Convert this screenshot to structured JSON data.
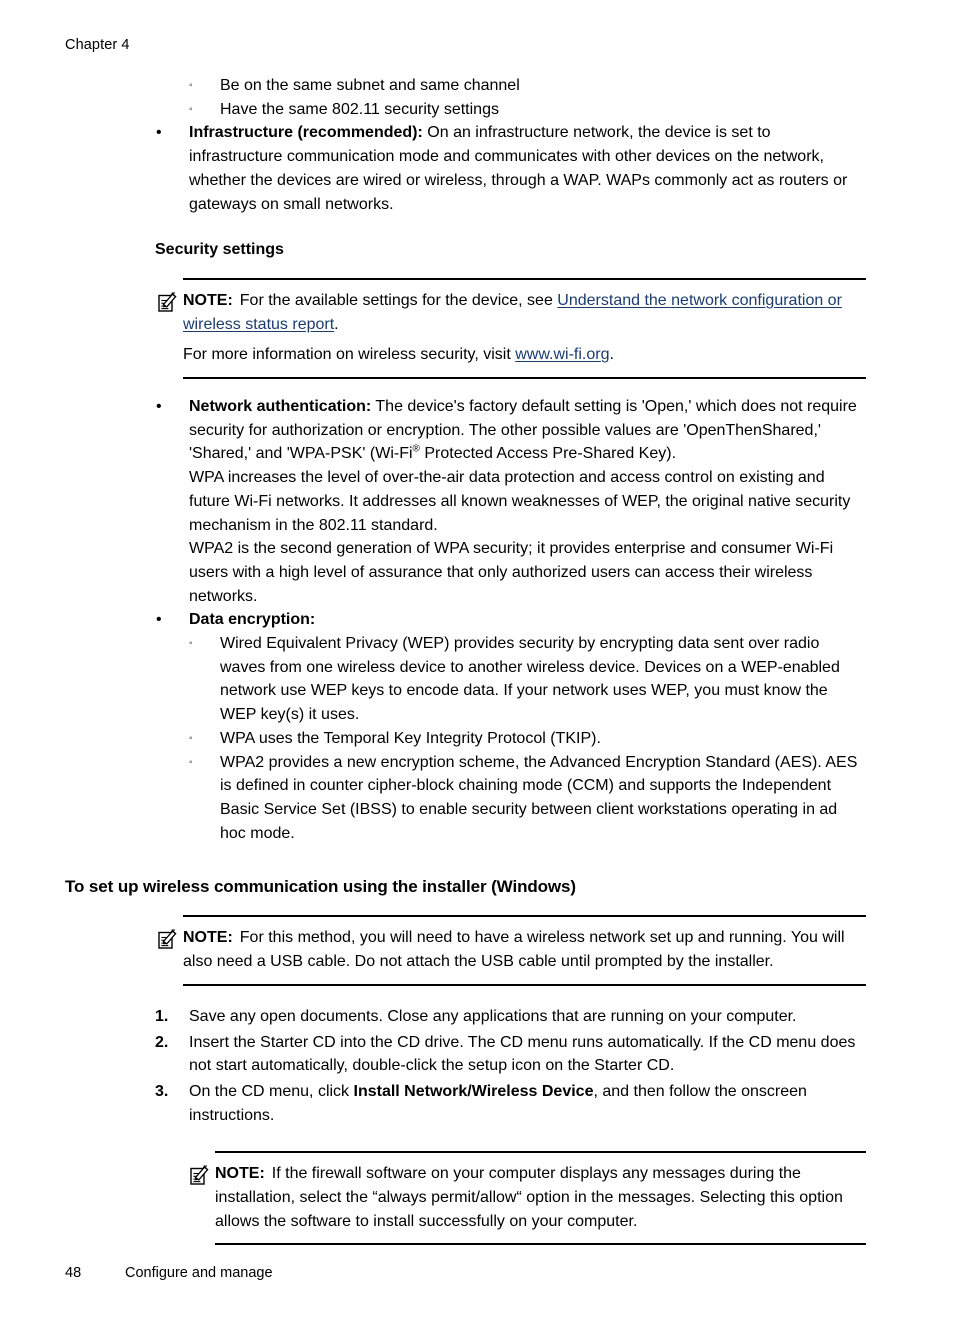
{
  "header": {
    "chapter": "Chapter 4"
  },
  "footer": {
    "page_number": "48",
    "section": "Configure and manage"
  },
  "ad_hoc_bullets": [
    "Be on the same subnet and same channel",
    "Have the same 802.11 security settings"
  ],
  "infrastructure": {
    "label": "Infrastructure (recommended):",
    "text": " On an infrastructure network, the device is set to infrastructure communication mode and communicates with other devices on the network, whether the devices are wired or wireless, through a WAP. WAPs commonly act as routers or gateways on small networks."
  },
  "security_settings_heading": "Security settings",
  "note_1": {
    "label": "NOTE:",
    "text_before_link": "For the available settings for the device, see ",
    "link_text": "Understand the network configuration or wireless status report",
    "text_after_link": ".",
    "second_para_before_link": "For more information on wireless security, visit ",
    "second_link_text": "www.wi-fi.org",
    "second_para_after_link": "."
  },
  "network_authentication": {
    "label": "Network authentication:",
    "text_part_1": " The device's factory default setting is 'Open,' which does not require security for authorization or encryption. The other possible values are 'OpenThenShared,' 'Shared,' and 'WPA-PSK' (Wi-Fi",
    "registered_mark": "®",
    "text_part_2": " Protected Access Pre-Shared Key).",
    "paragraph_2": "WPA increases the level of over-the-air data protection and access control on existing and future Wi-Fi networks. It addresses all known weaknesses of WEP, the original native security mechanism in the 802.11 standard.",
    "paragraph_3": "WPA2 is the second generation of WPA security; it provides enterprise and consumer Wi-Fi users with a high level of assurance that only authorized users can access their wireless networks."
  },
  "data_encryption": {
    "label": "Data encryption:",
    "items": [
      "Wired Equivalent Privacy (WEP) provides security by encrypting data sent over radio waves from one wireless device to another wireless device. Devices on a WEP-enabled network use WEP keys to encode data. If your network uses WEP, you must know the WEP key(s) it uses.",
      "WPA uses the Temporal Key Integrity Protocol (TKIP).",
      "WPA2 provides a new encryption scheme, the Advanced Encryption Standard (AES). AES is defined in counter cipher-block chaining mode (CCM) and supports the Independent Basic Service Set (IBSS) to enable security between client workstations operating in ad hoc mode."
    ]
  },
  "installer_section": {
    "heading": "To set up wireless communication using the installer (Windows)",
    "note": {
      "label": "NOTE:",
      "text": "For this method, you will need to have a wireless network set up and running. You will also need a USB cable. Do not attach the USB cable until prompted by the installer."
    },
    "steps": [
      {
        "number": "1.",
        "text": "Save any open documents. Close any applications that are running on your computer.",
        "bold_segment": "",
        "text_after_bold": ""
      },
      {
        "number": "2.",
        "text": "Insert the Starter CD into the CD drive. The CD menu runs automatically. If the CD menu does not start automatically, double-click the setup icon on the Starter CD.",
        "bold_segment": "",
        "text_after_bold": ""
      },
      {
        "number": "3.",
        "text": "On the CD menu, click ",
        "bold_segment": "Install Network/Wireless Device",
        "text_after_bold": ", and then follow the onscreen instructions."
      }
    ],
    "final_note": {
      "label": "NOTE:",
      "text": "If the firewall software on your computer displays any messages during the installation, select the “always permit/allow“ option in the messages. Selecting this option allows the software to install successfully on your computer."
    }
  },
  "markers": {
    "bullet_level1": "•",
    "bullet_level2": "◦"
  },
  "colors": {
    "link": "#1b3c6e",
    "text": "#000000",
    "background": "#ffffff"
  }
}
